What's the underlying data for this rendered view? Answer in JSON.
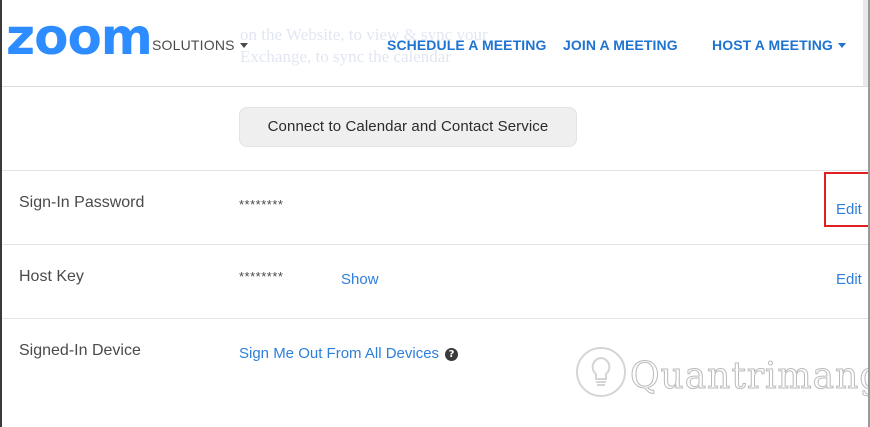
{
  "header": {
    "logo": "zoom",
    "solutions_label": "SOLUTIONS",
    "schedule_label": "SCHEDULE A MEETING",
    "join_label": "JOIN A MEETING",
    "host_label": "HOST A MEETING",
    "background_text_line1": "on the Website, to view & sync your",
    "background_text_line2": "Exchange, to sync the calendar"
  },
  "connect": {
    "button_label": "Connect to Calendar and Contact Service"
  },
  "rows": [
    {
      "label": "Sign-In Password",
      "value": "********",
      "edit_label": "Edit"
    },
    {
      "label": "Host Key",
      "value": "********",
      "show_label": "Show",
      "edit_label": "Edit"
    },
    {
      "label": "Signed-In Device",
      "link_label": "Sign Me Out From All Devices",
      "help_glyph": "?"
    }
  ],
  "watermark": {
    "text": "Quantrimang",
    "icon": "lightbulb-icon"
  },
  "colors": {
    "brand": "#2d8cff",
    "link": "#2d7fdc",
    "highlight": "#e02020"
  }
}
